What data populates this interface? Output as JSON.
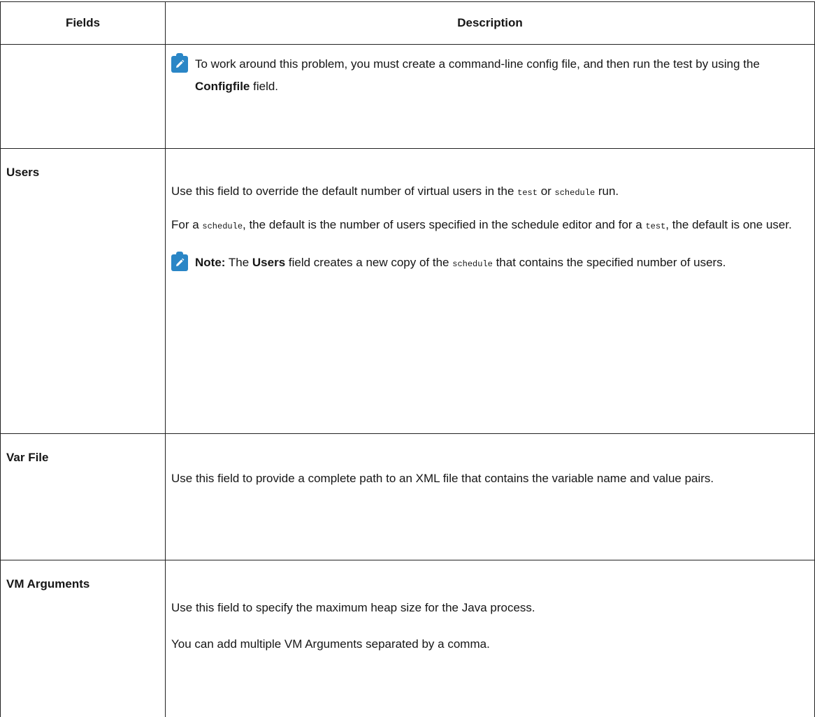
{
  "headers": {
    "fields": "Fields",
    "description": "Description"
  },
  "row_workaround": {
    "text_1": "To work around this problem, you must create a command-line config file, and then run the test by using the ",
    "bold": "Configfile",
    "text_2": " field."
  },
  "row_users": {
    "field": "Users",
    "p1_a": "Use this field to override the default number of virtual users in the ",
    "p1_code1": "test",
    "p1_b": " or ",
    "p1_code2": "schedule",
    "p1_c": " run.",
    "p2_a": "For a ",
    "p2_code1": "schedule",
    "p2_b": ", the default is the number of users specified in the schedule editor and for a ",
    "p2_code2": "test",
    "p2_c": ", the default is one user.",
    "note_label": "Note:",
    "note_a": " The ",
    "note_bold": "Users",
    "note_b": " field creates a new copy of the ",
    "note_code": "schedule",
    "note_c": " that contains the specified number of users."
  },
  "row_varfile": {
    "field": "Var File",
    "p1": "Use this field to provide a complete path to an XML file that contains the variable name and value pairs."
  },
  "row_vmargs": {
    "field": "VM Arguments",
    "p1": "Use this field to specify the maximum heap size for the Java process.",
    "p2": "You can add multiple VM Arguments separated by a comma."
  },
  "icons": {
    "note": "note-pencil-icon",
    "note_color": "#2a86c6"
  }
}
